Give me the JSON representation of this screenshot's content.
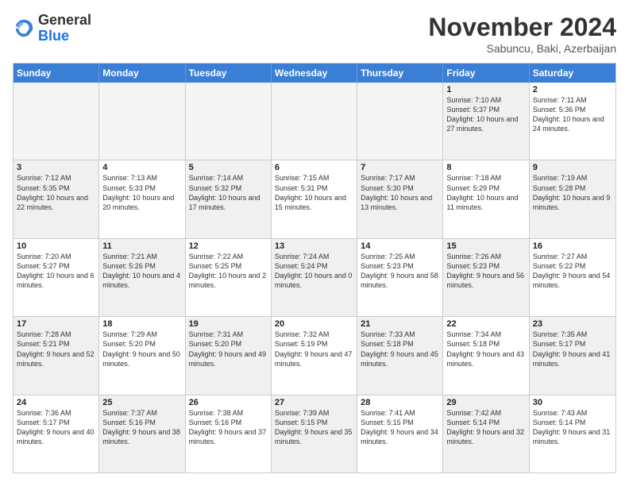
{
  "logo": {
    "line1": "General",
    "line2": "Blue"
  },
  "title": "November 2024",
  "location": "Sabuncu, Baki, Azerbaijan",
  "headers": [
    "Sunday",
    "Monday",
    "Tuesday",
    "Wednesday",
    "Thursday",
    "Friday",
    "Saturday"
  ],
  "rows": [
    [
      {
        "day": "",
        "text": "",
        "empty": true
      },
      {
        "day": "",
        "text": "",
        "empty": true
      },
      {
        "day": "",
        "text": "",
        "empty": true
      },
      {
        "day": "",
        "text": "",
        "empty": true
      },
      {
        "day": "",
        "text": "",
        "empty": true
      },
      {
        "day": "1",
        "text": "Sunrise: 7:10 AM\nSunset: 5:37 PM\nDaylight: 10 hours and 27 minutes.",
        "shaded": true
      },
      {
        "day": "2",
        "text": "Sunrise: 7:11 AM\nSunset: 5:36 PM\nDaylight: 10 hours and 24 minutes.",
        "shaded": false
      }
    ],
    [
      {
        "day": "3",
        "text": "Sunrise: 7:12 AM\nSunset: 5:35 PM\nDaylight: 10 hours and 22 minutes.",
        "shaded": true
      },
      {
        "day": "4",
        "text": "Sunrise: 7:13 AM\nSunset: 5:33 PM\nDaylight: 10 hours and 20 minutes.",
        "shaded": false
      },
      {
        "day": "5",
        "text": "Sunrise: 7:14 AM\nSunset: 5:32 PM\nDaylight: 10 hours and 17 minutes.",
        "shaded": true
      },
      {
        "day": "6",
        "text": "Sunrise: 7:15 AM\nSunset: 5:31 PM\nDaylight: 10 hours and 15 minutes.",
        "shaded": false
      },
      {
        "day": "7",
        "text": "Sunrise: 7:17 AM\nSunset: 5:30 PM\nDaylight: 10 hours and 13 minutes.",
        "shaded": true
      },
      {
        "day": "8",
        "text": "Sunrise: 7:18 AM\nSunset: 5:29 PM\nDaylight: 10 hours and 11 minutes.",
        "shaded": false
      },
      {
        "day": "9",
        "text": "Sunrise: 7:19 AM\nSunset: 5:28 PM\nDaylight: 10 hours and 9 minutes.",
        "shaded": true
      }
    ],
    [
      {
        "day": "10",
        "text": "Sunrise: 7:20 AM\nSunset: 5:27 PM\nDaylight: 10 hours and 6 minutes.",
        "shaded": false
      },
      {
        "day": "11",
        "text": "Sunrise: 7:21 AM\nSunset: 5:26 PM\nDaylight: 10 hours and 4 minutes.",
        "shaded": true
      },
      {
        "day": "12",
        "text": "Sunrise: 7:22 AM\nSunset: 5:25 PM\nDaylight: 10 hours and 2 minutes.",
        "shaded": false
      },
      {
        "day": "13",
        "text": "Sunrise: 7:24 AM\nSunset: 5:24 PM\nDaylight: 10 hours and 0 minutes.",
        "shaded": true
      },
      {
        "day": "14",
        "text": "Sunrise: 7:25 AM\nSunset: 5:23 PM\nDaylight: 9 hours and 58 minutes.",
        "shaded": false
      },
      {
        "day": "15",
        "text": "Sunrise: 7:26 AM\nSunset: 5:23 PM\nDaylight: 9 hours and 56 minutes.",
        "shaded": true
      },
      {
        "day": "16",
        "text": "Sunrise: 7:27 AM\nSunset: 5:22 PM\nDaylight: 9 hours and 54 minutes.",
        "shaded": false
      }
    ],
    [
      {
        "day": "17",
        "text": "Sunrise: 7:28 AM\nSunset: 5:21 PM\nDaylight: 9 hours and 52 minutes.",
        "shaded": true
      },
      {
        "day": "18",
        "text": "Sunrise: 7:29 AM\nSunset: 5:20 PM\nDaylight: 9 hours and 50 minutes.",
        "shaded": false
      },
      {
        "day": "19",
        "text": "Sunrise: 7:31 AM\nSunset: 5:20 PM\nDaylight: 9 hours and 49 minutes.",
        "shaded": true
      },
      {
        "day": "20",
        "text": "Sunrise: 7:32 AM\nSunset: 5:19 PM\nDaylight: 9 hours and 47 minutes.",
        "shaded": false
      },
      {
        "day": "21",
        "text": "Sunrise: 7:33 AM\nSunset: 5:18 PM\nDaylight: 9 hours and 45 minutes.",
        "shaded": true
      },
      {
        "day": "22",
        "text": "Sunrise: 7:34 AM\nSunset: 5:18 PM\nDaylight: 9 hours and 43 minutes.",
        "shaded": false
      },
      {
        "day": "23",
        "text": "Sunrise: 7:35 AM\nSunset: 5:17 PM\nDaylight: 9 hours and 41 minutes.",
        "shaded": true
      }
    ],
    [
      {
        "day": "24",
        "text": "Sunrise: 7:36 AM\nSunset: 5:17 PM\nDaylight: 9 hours and 40 minutes.",
        "shaded": false
      },
      {
        "day": "25",
        "text": "Sunrise: 7:37 AM\nSunset: 5:16 PM\nDaylight: 9 hours and 38 minutes.",
        "shaded": true
      },
      {
        "day": "26",
        "text": "Sunrise: 7:38 AM\nSunset: 5:16 PM\nDaylight: 9 hours and 37 minutes.",
        "shaded": false
      },
      {
        "day": "27",
        "text": "Sunrise: 7:39 AM\nSunset: 5:15 PM\nDaylight: 9 hours and 35 minutes.",
        "shaded": true
      },
      {
        "day": "28",
        "text": "Sunrise: 7:41 AM\nSunset: 5:15 PM\nDaylight: 9 hours and 34 minutes.",
        "shaded": false
      },
      {
        "day": "29",
        "text": "Sunrise: 7:42 AM\nSunset: 5:14 PM\nDaylight: 9 hours and 32 minutes.",
        "shaded": true
      },
      {
        "day": "30",
        "text": "Sunrise: 7:43 AM\nSunset: 5:14 PM\nDaylight: 9 hours and 31 minutes.",
        "shaded": false
      }
    ]
  ]
}
